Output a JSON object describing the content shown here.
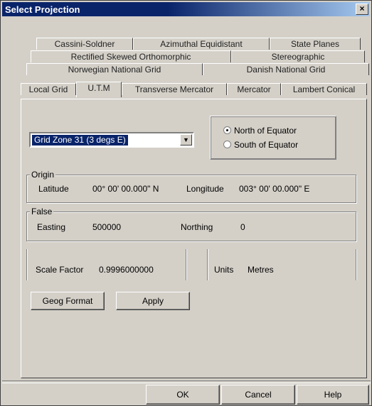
{
  "window": {
    "title": "Select Projection",
    "close_glyph": "×"
  },
  "tabs": {
    "row1": [
      "Cassini-Soldner",
      "Azimuthal Equidistant",
      "State Planes"
    ],
    "row2": [
      "Rectified Skewed Orthomorphic",
      "Stereographic"
    ],
    "row3": [
      "Norwegian National Grid",
      "Danish National Grid"
    ],
    "row4": [
      "Local Grid",
      "U.T.M",
      "Transverse Mercator",
      "Mercator",
      "Lambert Conical"
    ],
    "active": "U.T.M"
  },
  "zone_select": {
    "value": "Grid Zone 31  (3 degs E)",
    "arrow_glyph": "▼"
  },
  "hemisphere": {
    "options": [
      "North of Equator",
      "South of Equator"
    ],
    "selected": "North of Equator"
  },
  "origin": {
    "legend": "Origin",
    "latitude_label": "Latitude",
    "latitude_value": "00° 00' 00.000\" N",
    "longitude_label": "Longitude",
    "longitude_value": "003° 00' 00.000\" E"
  },
  "false": {
    "legend": "False",
    "easting_label": "Easting",
    "easting_value": "500000",
    "northing_label": "Northing",
    "northing_value": "0"
  },
  "scale": {
    "label": "Scale Factor",
    "value": "0.9996000000",
    "units_label": "Units",
    "units_value": "Metres"
  },
  "actions": {
    "geog_format": "Geog Format",
    "apply": "Apply"
  },
  "footer": {
    "ok": "OK",
    "cancel": "Cancel",
    "help": "Help"
  }
}
